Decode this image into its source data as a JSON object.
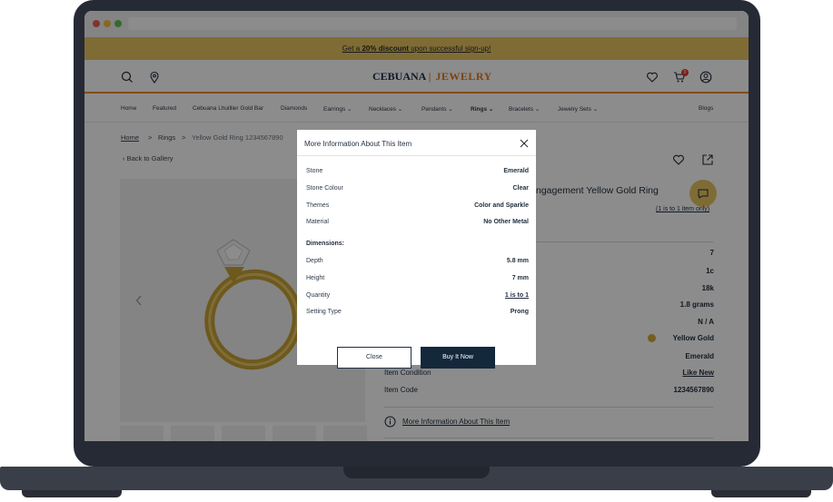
{
  "promo": {
    "prefix": "Get a ",
    "highlight": "20% discount",
    "suffix": " upon successful sign-up!"
  },
  "logo": {
    "brand": "CEBUANA",
    "sub": "LHUILLIER",
    "jewelry": "JEWELRY"
  },
  "cart_count": "0",
  "nav": [
    "Home",
    "Featured",
    "Cebuana Lhuillier Gold Bar",
    "Diamonds",
    "Earrings",
    "Necklaces",
    "Pendants",
    "Rings",
    "Bracelets",
    "Jewelry Sets",
    "Blogs"
  ],
  "breadcrumb": {
    "home": "Home",
    "rings": "Rings",
    "current": "Yellow Gold Ring 1234567890",
    "sep": ">"
  },
  "back_to_gallery": "Back to Gallery",
  "product": {
    "title": "ngagement Yellow Gold Ring",
    "quantity_note": "(1 is to 1 item only)",
    "right_values": [
      "7",
      "1c",
      "18k",
      "1.8 grams",
      "N / A",
      "Yellow Gold",
      "Emerald"
    ],
    "gold_color": "#d4a935",
    "item_condition_label": "Item Condition",
    "item_condition_value": "Like New",
    "item_code_label": "Item Code",
    "item_code_value": "1234567890",
    "more_info_link": "More Information About This Item"
  },
  "modal": {
    "title": "More Information About This Item",
    "rows": [
      {
        "label": "Stone",
        "value": "Emerald"
      },
      {
        "label": "Stone Colour",
        "value": "Clear"
      },
      {
        "label": "Themes",
        "value": "Color and Sparkle"
      },
      {
        "label": "Material",
        "value": "No Other Metal"
      }
    ],
    "dimensions_heading": "Dimensions:",
    "dim_rows": [
      {
        "label": "Depth",
        "value": "5.8 mm"
      },
      {
        "label": "Height",
        "value": "7 mm"
      },
      {
        "label": "Quantity",
        "value": "1 is to 1"
      },
      {
        "label": "Setting Type",
        "value": "Prong"
      }
    ],
    "close_label": "Close",
    "buy_label": "Buy It Now"
  },
  "colors": {
    "accent": "#ef8a2b",
    "promo": "#e8c562",
    "navy": "#14283c",
    "chat": "#e8c562"
  }
}
